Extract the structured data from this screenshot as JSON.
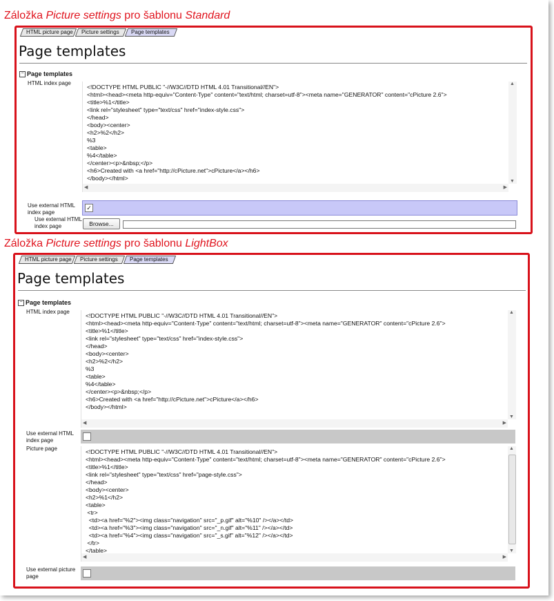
{
  "captions": [
    {
      "prefix": "Záložka ",
      "italic": "Picture settings",
      "mid": " pro šablonu ",
      "italic2": "Standard"
    },
    {
      "prefix": "Záložka ",
      "italic": "Picture settings",
      "mid": " pro šablonu ",
      "italic2": "LightBox"
    }
  ],
  "tabs": [
    "HTML picture page",
    "Picture settings",
    "Page templates"
  ],
  "page_title": "Page templates",
  "group_title": "Page templates",
  "group_toggle": "−",
  "standard": {
    "html_index_label": "HTML index page",
    "html_index_code": "<!DOCTYPE HTML PUBLIC \"-//W3C//DTD HTML 4.01 Transitional//EN\">\n<html><head><meta http-equiv=\"Content-Type\" content=\"text/html; charset=utf-8\"><meta name=\"GENERATOR\" content=\"cPicture 2.6\">\n<title>%1</title>\n<link rel=\"stylesheet\" type=\"text/css\" href=\"index-style.css\">\n</head>\n<body><center>\n<h2>%2</h2>\n%3\n<table>\n%4</table>\n</center><p>&nbsp;</p>\n<h6>Created with <a href=\"http://cPicture.net\">cPicture</a></h6>\n</body></html>",
    "use_external_label": "Use external HTML index page",
    "use_external_checked": true,
    "use_external_mark": "✓",
    "external_path_label": "Use external HTML index page",
    "browse_label": "Browse...",
    "path_value": ""
  },
  "lightbox": {
    "html_index_label": "HTML index page",
    "html_index_code": "<!DOCTYPE HTML PUBLIC \"-//W3C//DTD HTML 4.01 Transitional//EN\">\n<html><head><meta http-equiv=\"Content-Type\" content=\"text/html; charset=utf-8\"><meta name=\"GENERATOR\" content=\"cPicture 2.6\">\n<title>%1</title>\n<link rel=\"stylesheet\" type=\"text/css\" href=\"index-style.css\">\n</head>\n<body><center>\n<h2>%2</h2>\n%3\n<table>\n%4</table>\n</center><p>&nbsp;</p>\n<h6>Created with <a href=\"http://cPicture.net\">cPicture</a></h6>\n</body></html>",
    "use_external_label": "Use external HTML index page",
    "use_external_checked": false,
    "picture_page_label": "Picture page",
    "picture_page_code": "<!DOCTYPE HTML PUBLIC \"-//W3C//DTD HTML 4.01 Transitional//EN\">\n<html><head><meta http-equiv=\"Content-Type\" content=\"text/html; charset=utf-8\"><meta name=\"GENERATOR\" content=\"cPicture 2.6\">\n<title>%1</title>\n<link rel=\"stylesheet\" type=\"text/css\" href=\"page-style.css\">\n</head>\n<body><center>\n<h2>%1</h2>\n<table>\n <tr>\n  <td><a href=\"%2\"><img class=\"navigation\" src=\"_p.gif\" alt=\"%10\" /></a></td>\n  <td><a href=\"%3\"><img class=\"navigation\" src=\"_n.gif\" alt=\"%11\" /></a></td>\n  <td><a href=\"%4\"><img class=\"navigation\" src=\"_s.gif\" alt=\"%12\" /></a></td>\n </tr>\n</table>",
    "use_external_picture_label": "Use external picture page",
    "use_external_picture_checked": false
  },
  "colors": {
    "frame_border": "#d8121b",
    "caption_text": "#e0141e",
    "checked_row_bg": "#c8c8f8",
    "unchecked_row_bg": "#c8c8c8",
    "active_tab_bg": "#d8d8f4"
  }
}
